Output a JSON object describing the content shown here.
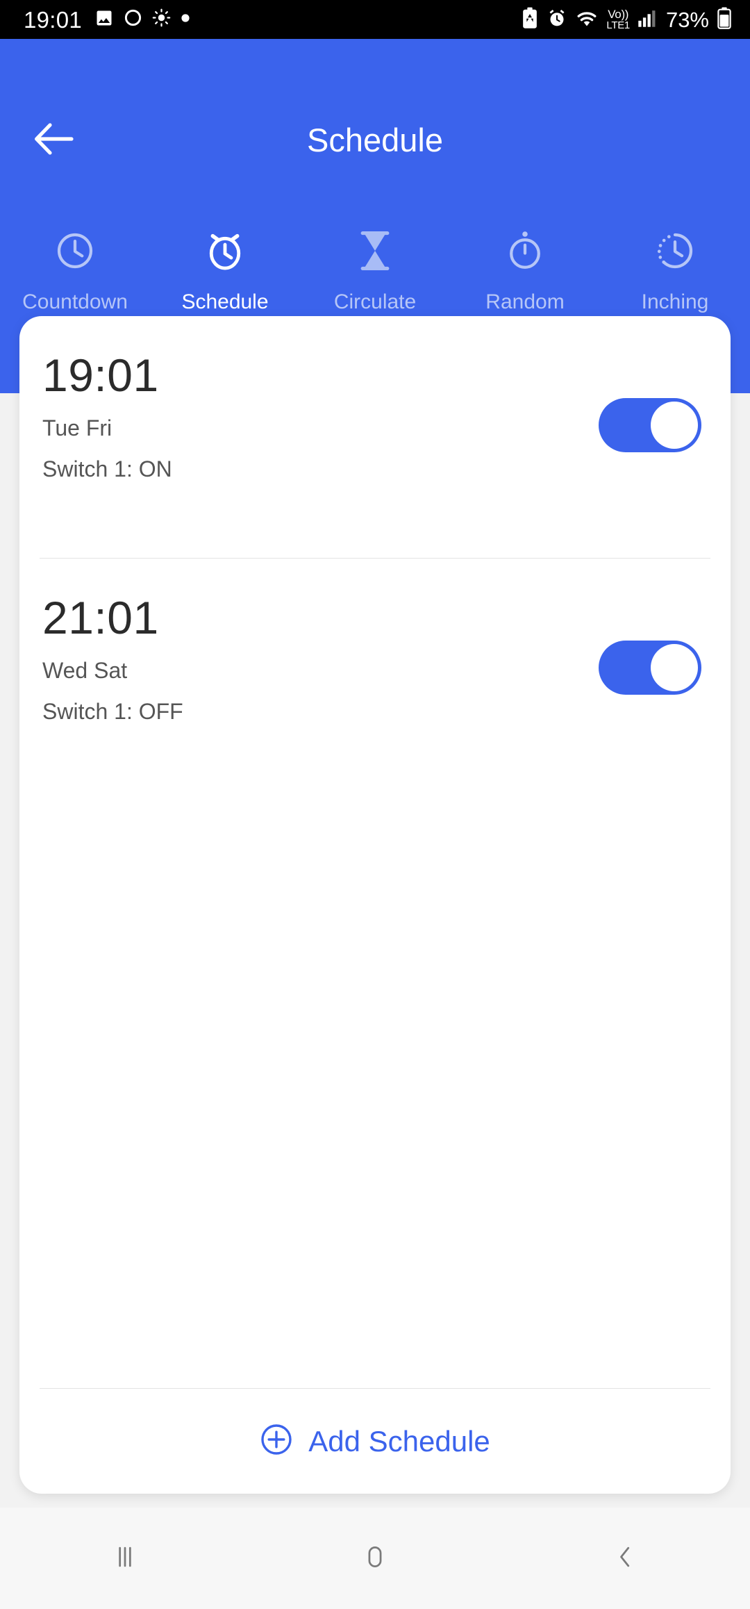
{
  "status_bar": {
    "time": "19:01",
    "battery_percent": "73%",
    "volte_top": "Vo))",
    "volte_bottom": "LTE1",
    "left_icons": [
      "photo-icon",
      "circle-icon",
      "brightness-icon",
      "dot-icon"
    ],
    "right_icons": [
      "battery-saver-icon",
      "alarm-icon",
      "wifi-icon",
      "volte-icon",
      "signal-icon",
      "battery-icon"
    ]
  },
  "header": {
    "title": "Schedule",
    "back_icon": "arrow-left-icon",
    "background_color": "#3b63ec"
  },
  "tabs": [
    {
      "label": "Countdown",
      "icon": "clock-icon",
      "active": false
    },
    {
      "label": "Schedule",
      "icon": "alarm-clock-icon",
      "active": true
    },
    {
      "label": "Circulate",
      "icon": "hourglass-icon",
      "active": false
    },
    {
      "label": "Random",
      "icon": "stopwatch-icon",
      "active": false
    },
    {
      "label": "Inching",
      "icon": "dashed-clock-icon",
      "active": false
    }
  ],
  "schedules": [
    {
      "time": "19:01",
      "days": "Tue Fri",
      "action": "Switch 1: ON",
      "enabled": true
    },
    {
      "time": "21:01",
      "days": "Wed Sat",
      "action": "Switch 1: OFF",
      "enabled": true
    }
  ],
  "add_schedule": {
    "label": "Add Schedule",
    "icon": "plus-circle-icon",
    "color": "#3b63ec"
  },
  "nav_bar": {
    "recents_icon": "recents-icon",
    "home_icon": "home-icon",
    "back_icon": "back-chevron-icon"
  },
  "theme": {
    "accent": "#3b63ec",
    "card_background": "#ffffff",
    "page_background": "#f2f2f2",
    "status_bar_background": "#000000",
    "inactive_tab_text": "#b6c6f7",
    "secondary_text": "#555555",
    "time_text": "#2b2b2b"
  }
}
